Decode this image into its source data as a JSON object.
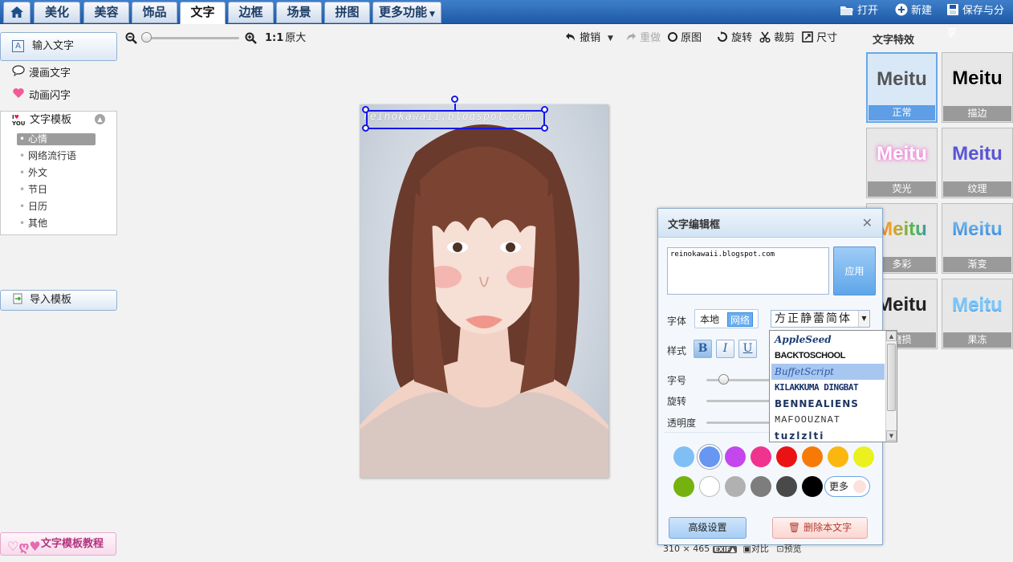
{
  "nav": {
    "tabs": [
      {
        "label": "美化"
      },
      {
        "label": "美容"
      },
      {
        "label": "饰品"
      },
      {
        "label": "文字"
      },
      {
        "label": "边框"
      },
      {
        "label": "场景"
      },
      {
        "label": "拼图"
      }
    ],
    "more_label": "更多功能",
    "open_label": "打开",
    "new_label": "新建",
    "save_label": "保存与分享",
    "active_tab": "文字"
  },
  "left": {
    "input_text": "输入文字",
    "comic_text": "漫画文字",
    "anim_text": "动画闪字",
    "templates_label": "文字模板",
    "template_categories": [
      "心情",
      "网络流行语",
      "外文",
      "节日",
      "日历",
      "其他"
    ],
    "active_category": "心情",
    "import_label": "导入模板",
    "tutorial_label": "文字模板教程"
  },
  "toolbar": {
    "ratio_label": "1:1",
    "original_size": "原大",
    "undo": "撤销",
    "redo": "重做",
    "original": "原图",
    "rotate": "旋转",
    "crop": "裁剪",
    "size": "尺寸"
  },
  "canvas": {
    "watermark": "reinokawaii.blogspot.com"
  },
  "dialog": {
    "title": "文字编辑框",
    "text_value": "reinokawaii.blogspot.com",
    "apply_label": "应用",
    "font_label": "字体",
    "font_local": "本地",
    "font_web": "网络",
    "font_selected": "方正静蕾简体",
    "style_label": "样式",
    "bold": "B",
    "italic": "I",
    "underline": "U",
    "size_label": "字号",
    "rotate_label": "旋转",
    "opacity_label": "透明度",
    "more_colors": "更多",
    "advanced_label": "高级设置",
    "delete_label": "删除本文字",
    "colors": [
      "#7fbff5",
      "#6897f2",
      "#c447ee",
      "#f0338f",
      "#ea1212",
      "#f87a06",
      "#fbb710",
      "#eaf11f",
      "#76b20f",
      "#ffffff",
      "#b1b1b1",
      "#7d7d7d",
      "#494949",
      "#000000"
    ],
    "selected_color_index": 1
  },
  "font_list": {
    "options": [
      "AppleSeed",
      "BACKTOSCHOOL",
      "BuffetScript",
      "KILAKKUMA DINGBAT",
      "BENNEALIENS",
      "MAFOOUZNAT",
      "tuzlzlti"
    ],
    "selected_index": 2
  },
  "status": {
    "dimensions": "310 × 465",
    "exif": "EXIF▲",
    "compare": "对比",
    "preview": "预览"
  },
  "effects": {
    "title": "文字特效",
    "sample_text": "Meitu",
    "items": [
      {
        "label": "正常",
        "color": "#555555"
      },
      {
        "label": "描边",
        "color": "#000000"
      },
      {
        "label": "荧光",
        "color": "#f47ad8"
      },
      {
        "label": "纹理",
        "color": "#5a55d6"
      },
      {
        "label": "多彩",
        "color": "#e94f4f"
      },
      {
        "label": "渐变",
        "color": "#3e93e0"
      },
      {
        "label": "磨损",
        "color": "#222222"
      },
      {
        "label": "果冻",
        "color": "#4ea7ec"
      }
    ],
    "active_index": 0
  }
}
